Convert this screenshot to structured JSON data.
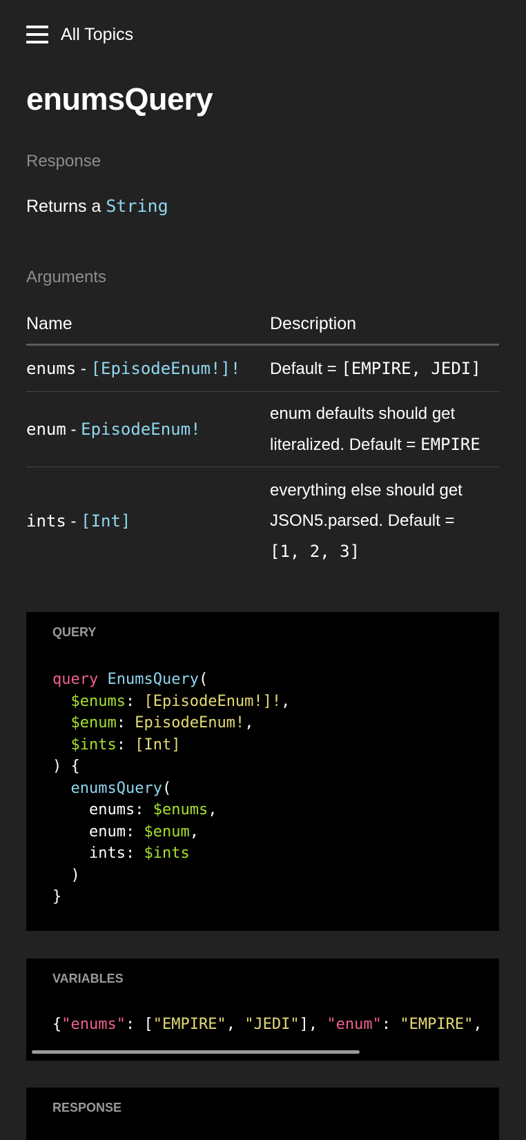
{
  "topbar": {
    "menu_icon": "hamburger-menu-icon",
    "title": "All Topics"
  },
  "page_title": "enumsQuery",
  "response": {
    "label": "Response",
    "returns_prefix": "Returns a",
    "returns_type": "String"
  },
  "arguments": {
    "label": "Arguments",
    "columns": [
      "Name",
      "Description"
    ],
    "rows": [
      {
        "name": "enums",
        "type": "[EpisodeEnum!]!",
        "desc_text": "Default =",
        "desc_code": "[EMPIRE, JEDI]"
      },
      {
        "name": "enum",
        "type": "EpisodeEnum!",
        "desc_line1": "enum defaults should get",
        "desc_line2_text": "literalized. Default =",
        "desc_code": "EMPIRE"
      },
      {
        "name": "ints",
        "type": "[Int]",
        "desc_line1": "everything else should get",
        "desc_line2_text": "JSON5.parsed. Default =",
        "desc_code": "[1, 2, 3]"
      }
    ]
  },
  "query_block": {
    "header": "QUERY",
    "code": {
      "keyword": "query",
      "operation": "EnumsQuery",
      "var_enums": "$enums",
      "type_enums": "[EpisodeEnum!]!",
      "var_enum": "$enum",
      "type_enum": "EpisodeEnum!",
      "var_ints": "$ints",
      "type_ints": "[Int]",
      "field": "enumsQuery",
      "arg_enums": "enums",
      "arg_enum": "enum",
      "arg_ints": "ints"
    }
  },
  "variables_block": {
    "header": "VARIABLES",
    "key_enums": "\"enums\"",
    "value_enums_1": "\"EMPIRE\"",
    "value_enums_2": "\"JEDI\"",
    "key_enum": "\"enum\"",
    "value_enum": "\"EMPIRE\""
  },
  "response_block": {
    "header": "RESPONSE"
  },
  "colors": {
    "background": "#222222",
    "code_background": "#000000",
    "type": "#8fd7ee",
    "keyword": "#f06289",
    "variable": "#a6e22e",
    "string": "#e6db74",
    "label": "#8d8d8d"
  }
}
